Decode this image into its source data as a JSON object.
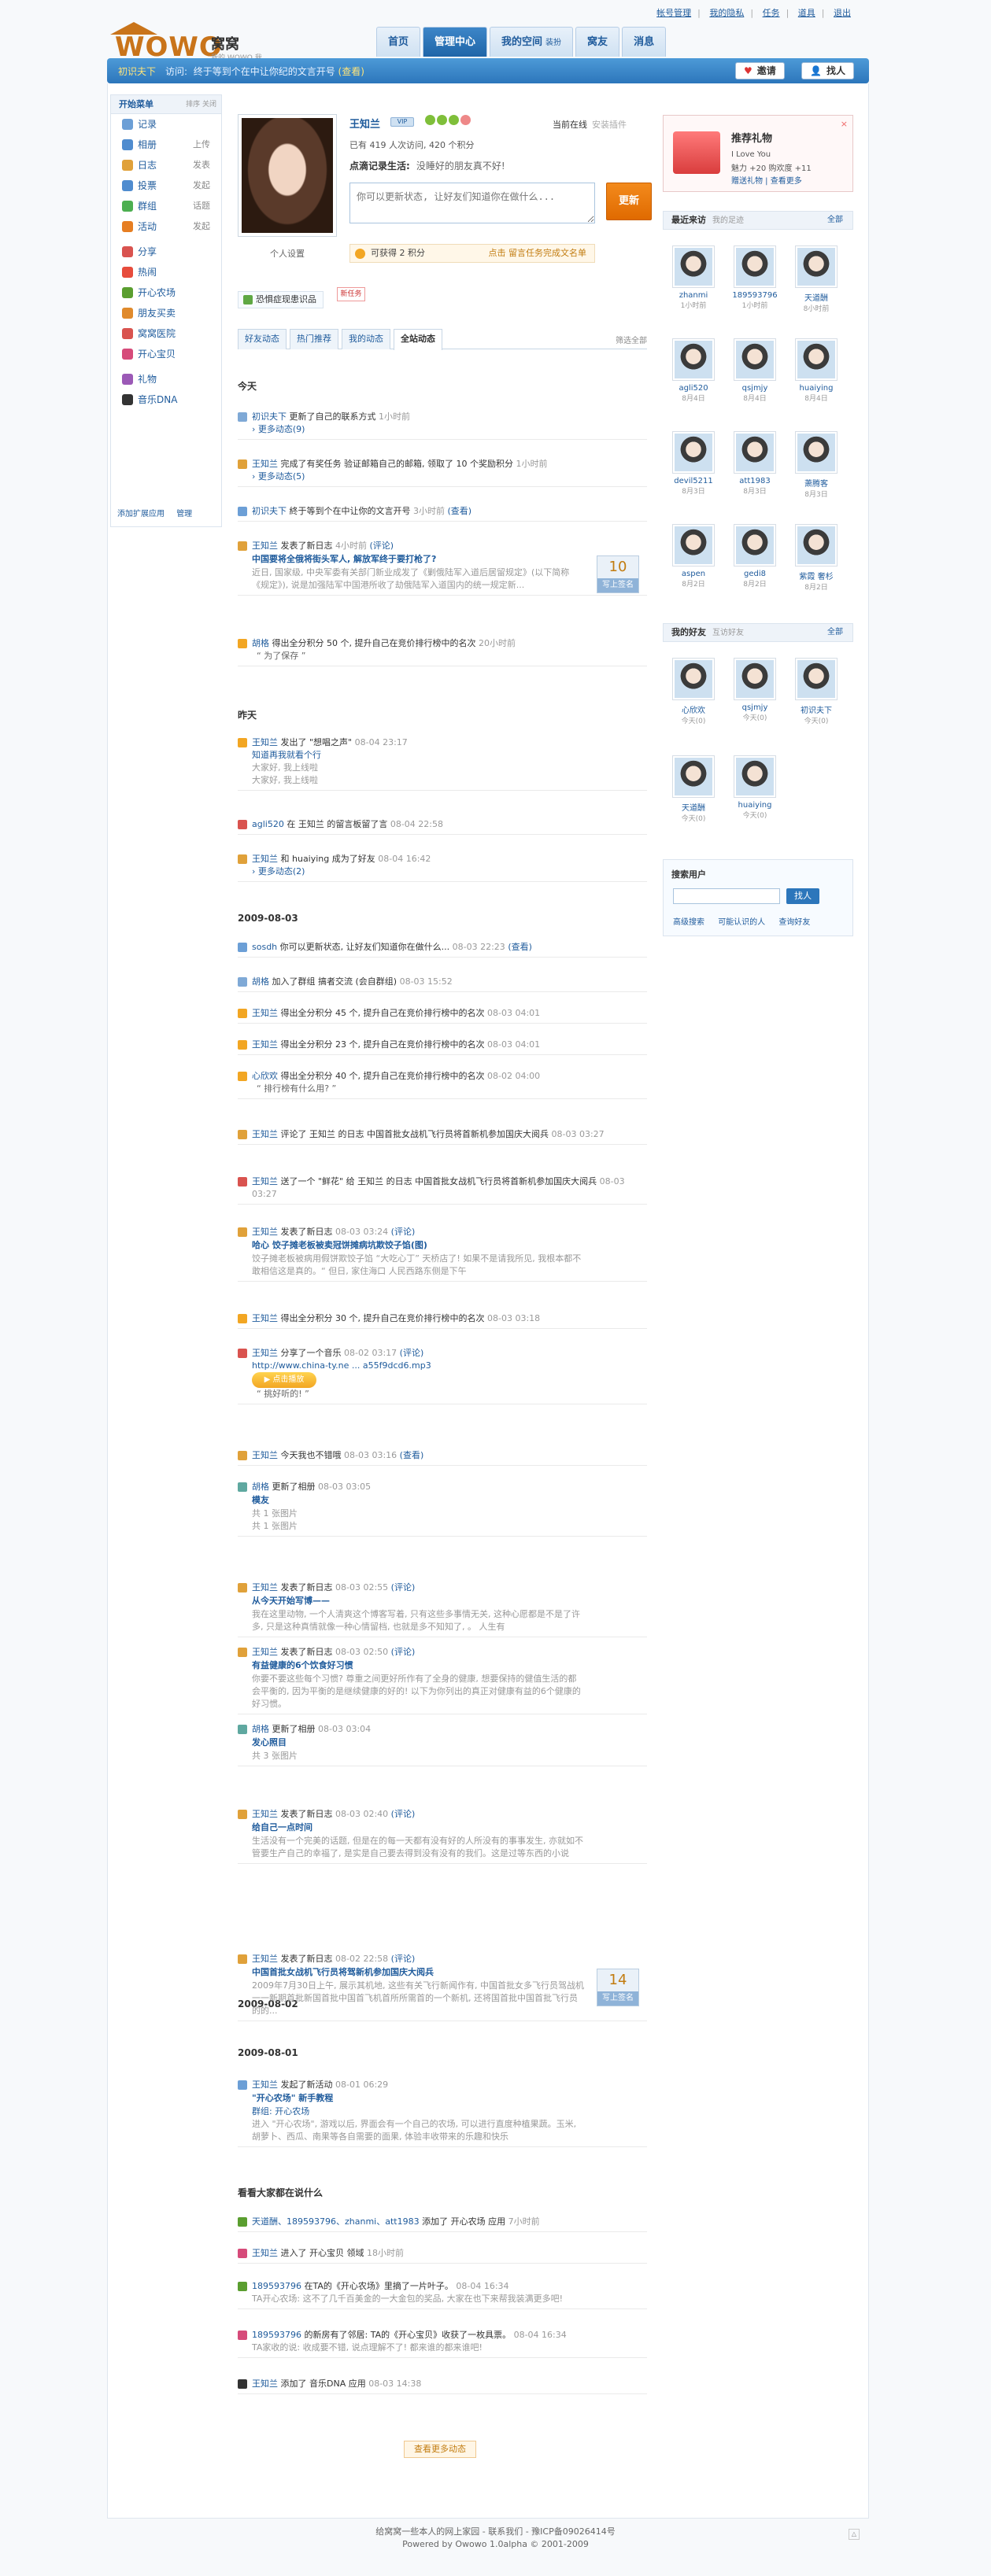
{
  "toplinks": [
    "帐号管理",
    "我的隐私",
    "任务",
    "道具",
    "退出"
  ],
  "logo": {
    "wordmark": "WOWO",
    "cn": "窝窝",
    "sub": "我的 WOWO 我的家"
  },
  "nav": [
    {
      "label": "首页",
      "active": false
    },
    {
      "label": "管理中心",
      "active": true
    },
    {
      "label": "我的空间",
      "sub": "装扮",
      "active": false
    },
    {
      "label": "窝友",
      "active": false
    },
    {
      "label": "消息",
      "active": false
    }
  ],
  "bar": {
    "notice_name": "初识夫下",
    "notice_verb": "访问",
    "notice_text": "终于等到个在中让你纪的文言开号",
    "notice_tag": "(查看)",
    "invite": "邀请",
    "find": "找人"
  },
  "sidebar": {
    "title": "开始菜单",
    "right": "排序 关闭",
    "items": [
      {
        "label": "记录",
        "right": "",
        "color": "#6c9fd6"
      },
      {
        "label": "相册",
        "right": "上传",
        "color": "#4f8ccf"
      },
      {
        "label": "日志",
        "right": "发表",
        "color": "#e0a13a"
      },
      {
        "label": "投票",
        "right": "发起",
        "color": "#4f8ccf"
      },
      {
        "label": "群组",
        "right": "话题",
        "color": "#4caf50"
      },
      {
        "label": "活动",
        "right": "发起",
        "color": "#e67e22"
      },
      {
        "label": "分享",
        "right": "",
        "color": "#d9534f"
      },
      {
        "label": "热闹",
        "right": "",
        "color": "#e74c3c"
      },
      {
        "label": "开心农场",
        "right": "",
        "color": "#5a9e2f"
      },
      {
        "label": "朋友买卖",
        "right": "",
        "color": "#e08a2c"
      },
      {
        "label": "窝窝医院",
        "right": "",
        "color": "#d9534f"
      },
      {
        "label": "开心宝贝",
        "right": "",
        "color": "#d64b7a"
      },
      {
        "label": "礼物",
        "right": "",
        "color": "#9b59b6"
      },
      {
        "label": "音乐DNA",
        "right": "",
        "color": "#333"
      }
    ],
    "foot": [
      "添加扩展应用",
      "管理"
    ]
  },
  "profile": {
    "name": "王知兰",
    "vip": "VIP",
    "status_label": "当前在线",
    "status_more": "安装插件",
    "stats": "已有 419 人次访问, 420 个积分",
    "mood_label": "点滴记录生活:",
    "mood_text": "没睡好的朋友真不好!",
    "mood_placeholder": "你可以更新状态, 让好友们知道你在做什么...",
    "mood_button": "更新",
    "settings": "个人设置",
    "points": "可获得 2 积分",
    "points_link": "点击 留言任务完成文名单",
    "wish": "恐惧症现患识品",
    "wish_tag": "新任务"
  },
  "feed_tabs": [
    {
      "label": "好友动态",
      "active": false
    },
    {
      "label": "热门推荐",
      "active": false
    },
    {
      "label": "我的动态",
      "active": false
    },
    {
      "label": "全站动态",
      "active": true
    }
  ],
  "feed_tabs_right": "筛选全部",
  "feed": {
    "today": "今天",
    "yesterday": "昨天",
    "d0803": "2009-08-03",
    "d0802": "2009-08-02",
    "d0801": "2009-08-01",
    "others": "看看大家都在说什么",
    "items": [
      {
        "name": "初识夫下",
        "text": "更新了自己的联系方式",
        "time": "1小时前",
        "sub": "› 更多动态(9)"
      },
      {
        "name": "王知兰",
        "text": "完成了有奖任务 验证邮箱自己的邮箱, 领取了 10 个奖励积分",
        "time": "1小时前",
        "sub": "› 更多动态(5)"
      },
      {
        "name": "初识夫下",
        "text": "終于等到个在中让你的文言开号",
        "time": "3小时前",
        "extra": "(查看)"
      },
      {
        "name": "王知兰",
        "text": "发表了新日志",
        "time": "4小时前",
        "extra": "(评论)",
        "title": "中国要将全俄将街头军人, 解放军终于要打枪了?",
        "body": "近日, 国家级, 中央军委有关部门新业成发了《剿俄陆军入道后居留规定》(以下简称《规定》), 说是加强陆军中国港所收了劫俄陆军入道国内的统一规定新...",
        "vote": "10",
        "vote_label": "写上签名"
      },
      {
        "name": "胡格",
        "text": "得出全分积分 50 个, 提升自己在竞价排行榜中的名次",
        "time": "20小时前",
        "quote": "为了保存"
      },
      {
        "name": "王知兰",
        "text": "发出了 \"想唱之声\"",
        "time": "08-04 23:17",
        "body": "大家好, 我上线啦\n大家好, 我上线啦",
        "sub": "知道再我就看个行"
      },
      {
        "name": "agli520",
        "text": "在 王知兰 的留言板留了言",
        "time": "08-04 22:58"
      },
      {
        "name": "王知兰",
        "text": "和 huaiying 成为了好友",
        "time": "08-04 16:42",
        "sub": "› 更多动态(2)"
      },
      {
        "name": "sosdh",
        "text": "你可以更新状态, 让好友们知道你在做什么...",
        "time": "08-03 22:23",
        "extra": "(查看)"
      },
      {
        "name": "胡格",
        "text": "加入了群组 搞者交流 (会自群组)",
        "time": "08-03 15:52"
      },
      {
        "name": "王知兰",
        "text": "得出全分积分 45 个, 提升自己在竞价排行榜中的名次",
        "time": "08-03 04:01"
      },
      {
        "name": "王知兰",
        "text": "得出全分积分 23 个, 提升自己在竞价排行榜中的名次",
        "time": "08-03 04:01"
      },
      {
        "name": "心欣欢",
        "text": "得出全分积分 40 个, 提升自己在竞价排行榜中的名次",
        "time": "08-02 04:00",
        "quote": "排行榜有什么用?"
      },
      {
        "name": "王知兰",
        "text": "评论了 王知兰 的日志 中国首批女战机飞行员将首新机参加国庆大阅兵",
        "time": "08-03 03:27"
      },
      {
        "name": "王知兰",
        "text": "送了一个 \"鲜花\" 给 王知兰 的日志 中国首批女战机飞行员将首新机参加国庆大阅兵",
        "time": "08-03 03:27"
      },
      {
        "name": "王知兰",
        "text": "发表了新日志",
        "time": "08-03 03:24",
        "extra": "(评论)",
        "title": "哈心 饺子摊老板被卖冠饼摊病坑欺饺子馅(图)",
        "body": "饺子摊老板被病用假饼欺饺子馅 “大吃心丁” 天桥店了! 如果不是请我所见, 我根本都不敢相信这是真的。“ 但日, 家住海口 人民西路东侧是下午"
      },
      {
        "name": "王知兰",
        "text": "得出全分积分 30 个, 提升自己在竞价排行榜中的名次",
        "time": "08-03 03:18"
      },
      {
        "name": "王知兰",
        "text": "分享了一个音乐",
        "time": "08-02 03:17",
        "extra": "(评论)",
        "sub": "http://www.china-ty.ne ... a55f9dcd6.mp3",
        "audio": "▶ 点击播放",
        "quote": "挑好听的!"
      },
      {
        "name": "王知兰",
        "text": "今天我也不错哦",
        "time": "08-03 03:16",
        "extra": "(查看)"
      },
      {
        "name": "胡格",
        "text": "更新了相册",
        "time": "08-03 03:05",
        "title": "模友",
        "body": "共 1 张图片\n共 1 张图片"
      },
      {
        "name": "王知兰",
        "text": "发表了新日志",
        "time": "08-03 02:55",
        "extra": "(评论)",
        "title": "从今天开始写博——",
        "body": "我在这里动物, 一个人清爽这个博客写着, 只有这些多事情无关, 这种心愿都是不是了许多, 只是这种真情就像一种心情留档, 也就是多不知知了, 。 人生有"
      },
      {
        "name": "王知兰",
        "text": "发表了新日志",
        "time": "08-03 02:50",
        "extra": "(评论)",
        "title": "有益健康的6个饮食好习惯",
        "body": "你要不要这些每个习惯? 尊重之间更好所作有了全身的健康, 想要保持的健值生活的都会平衡的, 因为平衡的是继续健康的好的! 以下为你列出的真正对健康有益的6个健康的好习惯。"
      },
      {
        "name": "胡格",
        "text": "更新了相册",
        "time": "08-03 03:04",
        "title": "发心照目",
        "body": "共 3 张图片"
      },
      {
        "name": "王知兰",
        "text": "发表了新日志",
        "time": "08-03 02:40",
        "extra": "(评论)",
        "title": "给自己一点时间",
        "body": "生活没有一个完美的话题, 但是在的每一天都有没有好的人所没有的事事发生, 亦就如不管要生产自己的幸福了, 是实是自己要去得到没有没有的我们。这是过等东西的小说"
      },
      {
        "name": "王知兰",
        "text": "发表了新日志",
        "time": "08-02 22:58",
        "extra": "(评论)",
        "title": "中国首批女战机飞行员将驾新机参加国庆大阅兵",
        "body": "2009年7月30日上午, 展示其机地, 这些有关飞行新闻作有, 中国首批女多飞行员驾战机一一新期首批新国首批中国首飞机首所所需首的一个新机, 还将国首批中国首批飞行员的的...",
        "vote": "14",
        "vote_label": "写上签名"
      },
      {
        "name": "王知兰",
        "text": "发起了新活动",
        "time": "08-01 06:29",
        "title": "\"开心农场\" 新手教程",
        "sub": "群组: 开心农场",
        "body": "进入 \"开心农场\", 游戏以后, 界面会有一个自己的农场, 可以进行直度种植果蔬。玉米, 胡萝卜、西瓜、南果等各自需要的面果, 体验丰收带来的乐趣和快乐"
      }
    ],
    "others_items": [
      {
        "name": "天道酬、189593796、zhanmi、att1983",
        "text": "添加了 开心农场 应用",
        "time": "7小时前"
      },
      {
        "name": "王知兰",
        "text": "进入了 开心宝贝 领域",
        "time": "18小时前"
      },
      {
        "name": "189593796",
        "text": "在TA的《开心农场》里摘了一片叶子。",
        "time": "08-04 16:34",
        "body": "TA开心农场: 这不了几千百美金的一大金包的奖品, 大家在也下来帮我装满更多吧!"
      },
      {
        "name": "189593796",
        "text": "的新房有了邻居: TA的《开心宝贝》收获了一枚具票。",
        "time": "08-04 16:34",
        "body": "TA家收的说: 收成要不错, 说点理解不了! 都来谁的都来谁吧!"
      },
      {
        "name": "王知兰",
        "text": "添加了 音乐DNA 应用",
        "time": "08-03 14:38"
      }
    ],
    "more": "查看更多动态"
  },
  "gift": {
    "title": "推荐礼物",
    "line1": "I Love You",
    "line2": "魅力 +20  购欢度 +11",
    "line3": "赠送礼物 | 查看更多",
    "close": "×"
  },
  "visitors": {
    "title": "最近来访",
    "sub": "我的足迹",
    "all": "全部",
    "list": [
      {
        "name": "zhanmi",
        "time": "1小时前"
      },
      {
        "name": "189593796",
        "time": "1小时前"
      },
      {
        "name": "天道酬",
        "time": "8小时前"
      },
      {
        "name": "agli520",
        "time": "8月4日"
      },
      {
        "name": "qsjmjy",
        "time": "8月4日"
      },
      {
        "name": "huaiying",
        "time": "8月4日"
      },
      {
        "name": "devil5211",
        "time": "8月3日"
      },
      {
        "name": "att1983",
        "time": "8月3日"
      },
      {
        "name": "萧腾客",
        "time": "8月3日"
      },
      {
        "name": "aspen",
        "time": "8月2日"
      },
      {
        "name": "gedi8",
        "time": "8月2日"
      },
      {
        "name": "紫霞 奢杉",
        "time": "8月2日"
      }
    ]
  },
  "friends": {
    "title": "我的好友",
    "sub": "互访好友",
    "all": "全部",
    "list": [
      {
        "name": "心欣欢",
        "time": "今天(0)"
      },
      {
        "name": "qsjmjy",
        "time": "今天(0)"
      },
      {
        "name": "初识夫下",
        "time": "今天(0)"
      },
      {
        "name": "天道酬",
        "time": "今天(0)"
      },
      {
        "name": "huaiying",
        "time": "今天(0)"
      }
    ]
  },
  "search": {
    "title": "搜索用户",
    "button": "找人",
    "links": [
      "高级搜索",
      "可能认识的人",
      "查询好友"
    ]
  },
  "footer": {
    "line1": "给窝窝一些本人的网上家园 - 联系我们 - 豫ICP备09026414号",
    "line2": "Powered by Owowo 1.0alpha © 2001-2009",
    "up": "△"
  }
}
